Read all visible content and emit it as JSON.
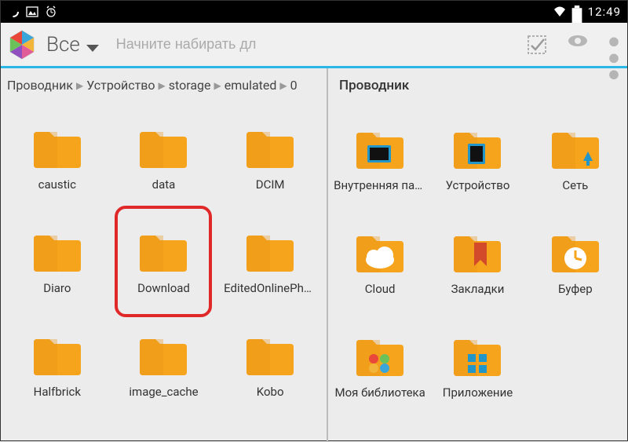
{
  "statusbar": {
    "time": "12:49"
  },
  "actionbar": {
    "spinner_label": "Все",
    "search_placeholder": "Начните набирать дл"
  },
  "breadcrumb": [
    "Проводник",
    "Устройство",
    "storage",
    "emulated",
    "0"
  ],
  "right_root": "Проводник",
  "folders_left": [
    {
      "label": "caustic",
      "icon": "plain"
    },
    {
      "label": "data",
      "icon": "plain"
    },
    {
      "label": "DCIM",
      "icon": "plain"
    },
    {
      "label": "Diaro",
      "icon": "plain"
    },
    {
      "label": "Download",
      "icon": "plain",
      "highlighted": true
    },
    {
      "label": "EditedOnlinePhotos",
      "icon": "plain"
    },
    {
      "label": "Halfbrick",
      "icon": "plain"
    },
    {
      "label": "image_cache",
      "icon": "plain"
    },
    {
      "label": "Kobo",
      "icon": "plain"
    }
  ],
  "folders_right": [
    {
      "label": "Внутренняя память",
      "icon": "internal"
    },
    {
      "label": "Устройство",
      "icon": "device"
    },
    {
      "label": "Сеть",
      "icon": "network"
    },
    {
      "label": "Cloud",
      "icon": "cloud"
    },
    {
      "label": "Закладки",
      "icon": "bookmark"
    },
    {
      "label": "Буфер",
      "icon": "clock"
    },
    {
      "label": "Моя библиотека",
      "icon": "dots"
    },
    {
      "label": "Приложение",
      "icon": "apps"
    }
  ]
}
